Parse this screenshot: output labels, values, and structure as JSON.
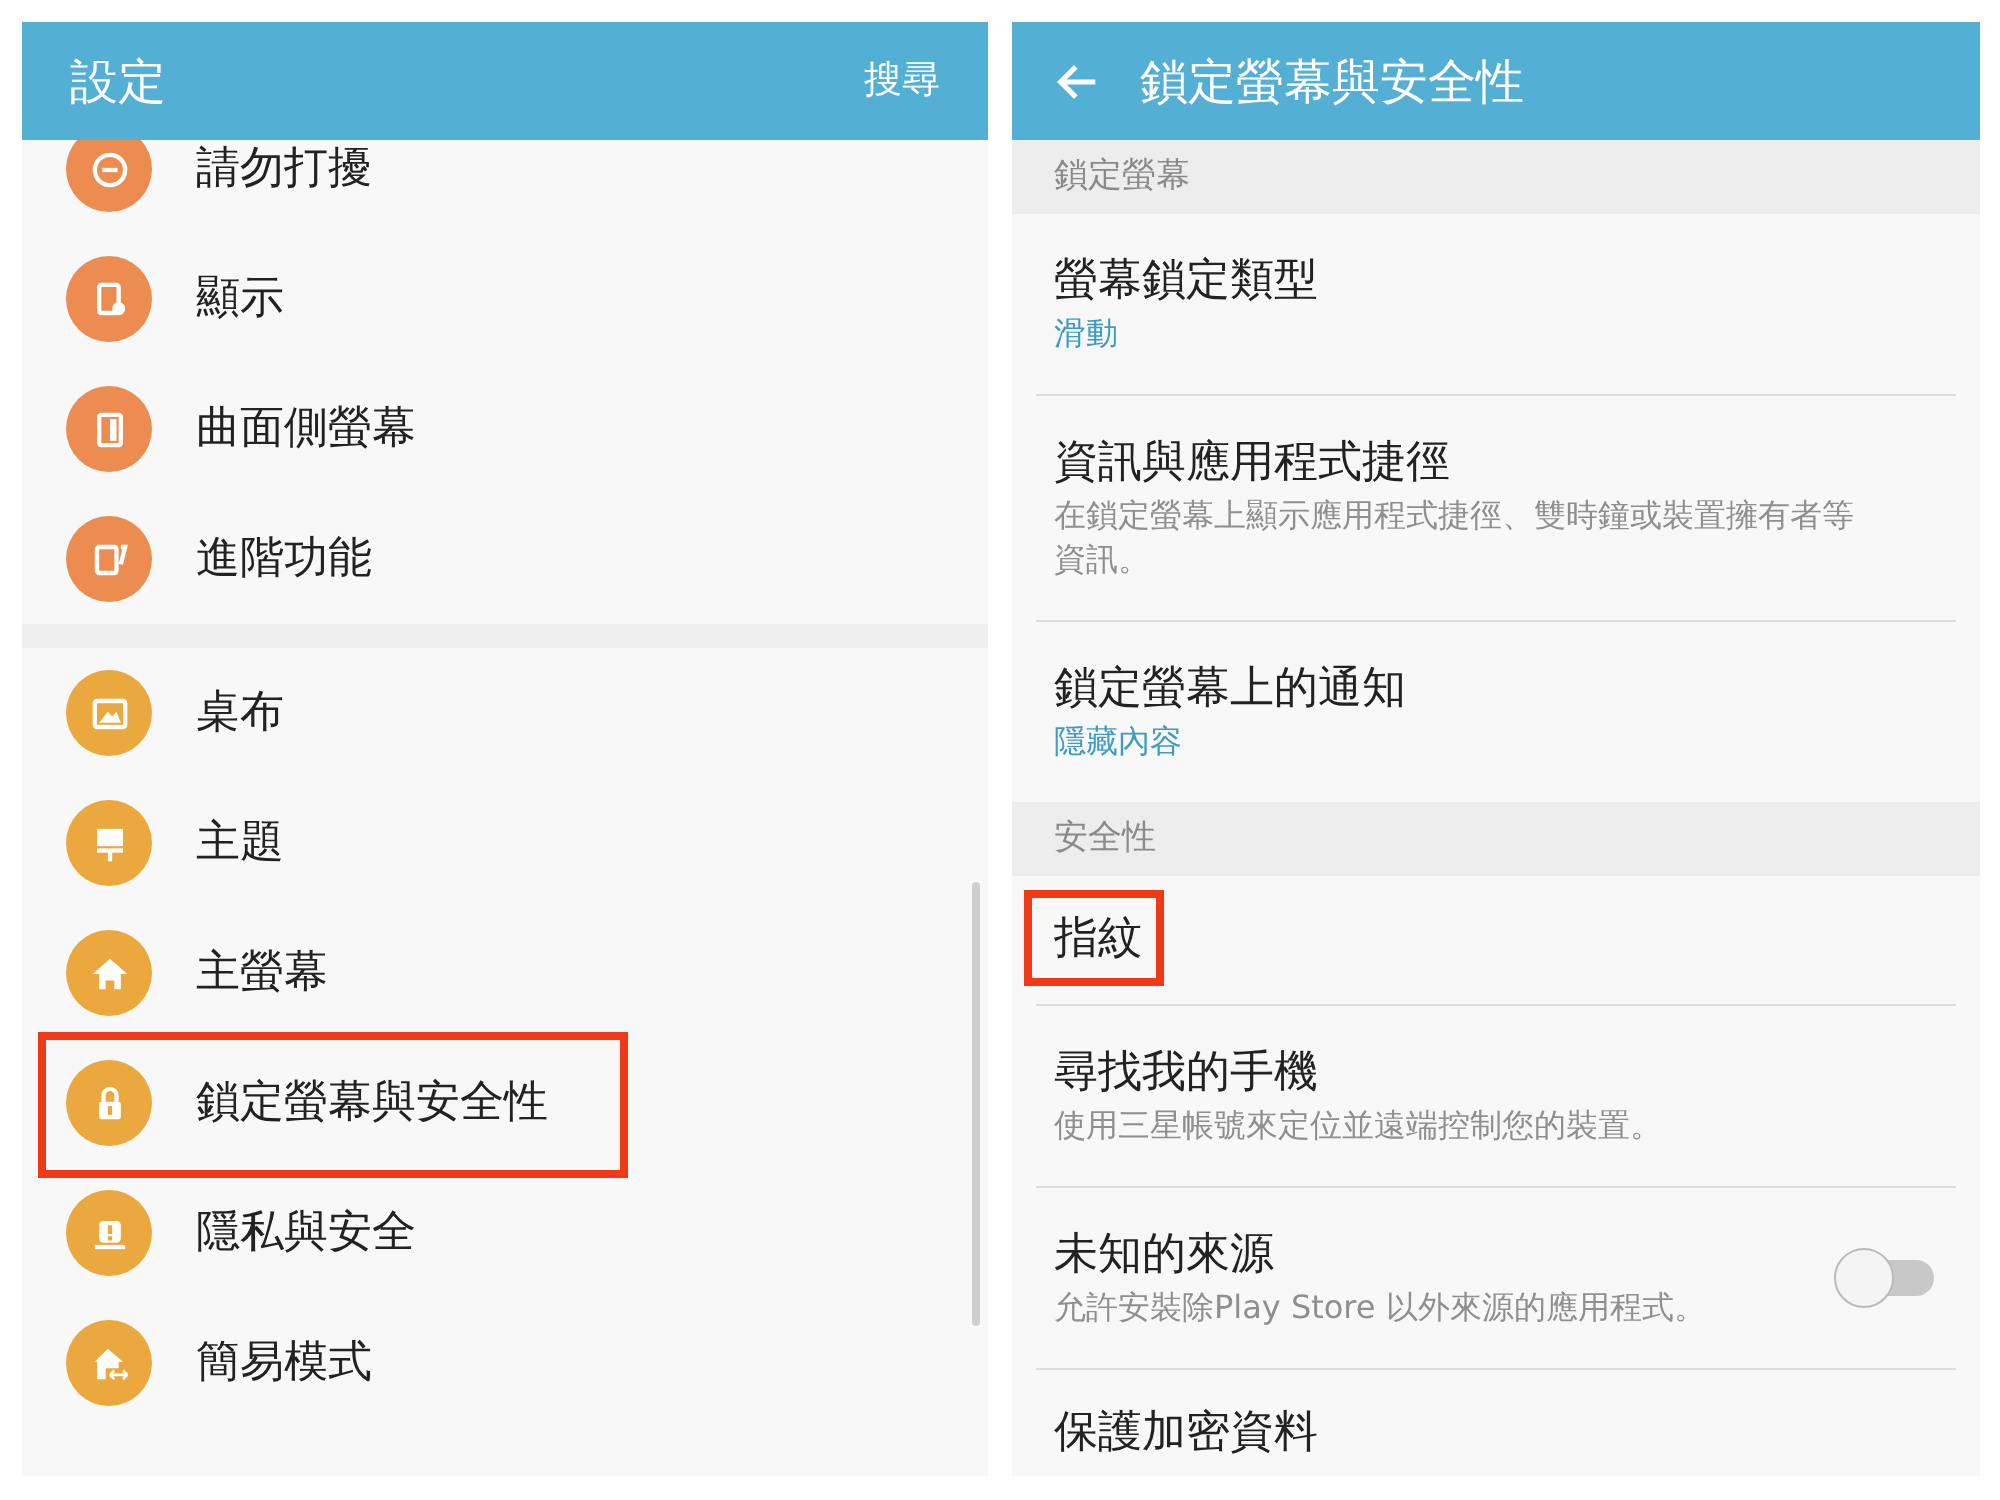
{
  "left_screen": {
    "title": "設定",
    "search": "搜尋",
    "groups": [
      {
        "color": "#ec8c50",
        "items": [
          {
            "label": "請勿打擾",
            "highlighted": false
          },
          {
            "label": "顯示",
            "highlighted": false
          },
          {
            "label": "曲面側螢幕",
            "highlighted": false
          },
          {
            "label": "進階功能",
            "highlighted": false
          }
        ]
      },
      {
        "color": "#eaa83e",
        "items": [
          {
            "label": "桌布",
            "highlighted": false
          },
          {
            "label": "主題",
            "highlighted": false
          },
          {
            "label": "主螢幕",
            "highlighted": false
          },
          {
            "label": "鎖定螢幕與安全性",
            "highlighted": true
          },
          {
            "label": "隱私與安全",
            "highlighted": false
          },
          {
            "label": "簡易模式",
            "highlighted": false
          }
        ]
      }
    ]
  },
  "right_screen": {
    "title": "鎖定螢幕與安全性",
    "sections": [
      {
        "header": "鎖定螢幕",
        "items": [
          {
            "kind": "value",
            "title": "螢幕鎖定類型",
            "subtitle": "滑動",
            "highlighted": false
          },
          {
            "kind": "description",
            "title": "資訊與應用程式捷徑",
            "subtitle": "在鎖定螢幕上顯示應用程式捷徑、雙時鐘或裝置擁有者等資訊。",
            "highlighted": false
          },
          {
            "kind": "value",
            "title": "鎖定螢幕上的通知",
            "subtitle": "隱藏內容",
            "highlighted": false
          }
        ]
      },
      {
        "header": "安全性",
        "items": [
          {
            "kind": "plain",
            "title": "指紋",
            "highlighted": true
          },
          {
            "kind": "description",
            "title": "尋找我的手機",
            "subtitle": "使用三星帳號來定位並遠端控制您的裝置。",
            "highlighted": false
          },
          {
            "kind": "description",
            "title": "未知的來源",
            "subtitle": "允許安裝除Play Store 以外來源的應用程式。",
            "toggle": {
              "on": false
            },
            "highlighted": false
          },
          {
            "kind": "plain",
            "title": "保護加密資料",
            "highlighted": false
          }
        ]
      }
    ]
  }
}
